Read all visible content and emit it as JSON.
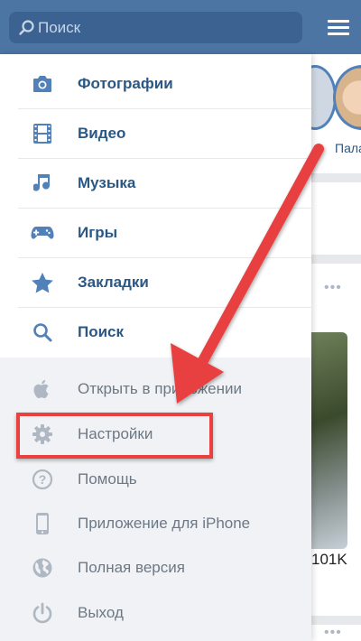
{
  "search": {
    "placeholder": "Поиск"
  },
  "menu_primary": [
    {
      "label": "Фотографии",
      "icon": "camera-icon"
    },
    {
      "label": "Видео",
      "icon": "film-icon"
    },
    {
      "label": "Музыка",
      "icon": "music-note-icon"
    },
    {
      "label": "Игры",
      "icon": "gamepad-icon"
    },
    {
      "label": "Закладки",
      "icon": "star-icon"
    },
    {
      "label": "Поиск",
      "icon": "search-icon"
    }
  ],
  "menu_secondary": [
    {
      "label": "Открыть в приложении",
      "icon": "apple-icon"
    },
    {
      "label": "Настройки",
      "icon": "gear-icon"
    },
    {
      "label": "Помощь",
      "icon": "help-icon"
    },
    {
      "label": "Приложение для iPhone",
      "icon": "phone-icon"
    },
    {
      "label": "Полная версия",
      "icon": "globe-icon"
    },
    {
      "label": "Выход",
      "icon": "power-icon"
    }
  ],
  "feed": {
    "story_name": "Пала",
    "dots": "•••",
    "views_count": "101K"
  },
  "colors": {
    "header": "#4c75a3",
    "primary_text": "#2a5885",
    "secondary_text": "#6d7885",
    "highlight": "#e8413f"
  }
}
